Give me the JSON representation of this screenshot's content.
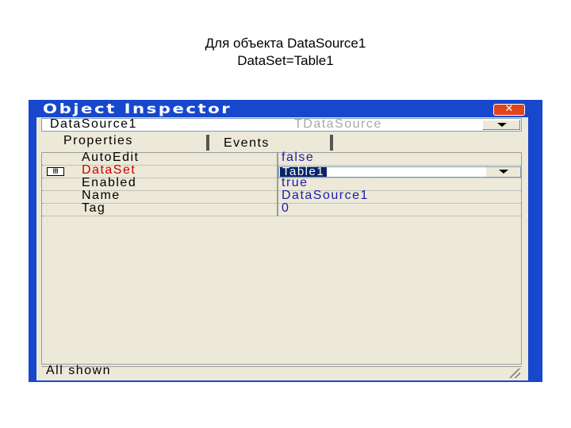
{
  "caption": {
    "line1": "Для объекта DataSource1",
    "line2": "DataSet=Table1"
  },
  "window": {
    "title": "Object Inspector",
    "close_glyph": "✕"
  },
  "selector": {
    "component_name": "DataSource1",
    "component_type": "TDataSource"
  },
  "tabs": [
    {
      "label": "Properties",
      "active": true
    },
    {
      "label": "Events",
      "active": false
    }
  ],
  "properties": [
    {
      "name": "AutoEdit",
      "value": "false"
    },
    {
      "name": "DataSet",
      "value": "Table1",
      "expandable": true,
      "selected": true
    },
    {
      "name": "Enabled",
      "value": "true"
    },
    {
      "name": "Name",
      "value": "DataSource1"
    },
    {
      "name": "Tag",
      "value": "0"
    }
  ],
  "expand_glyph": "⊞",
  "status": {
    "text": "All shown"
  },
  "colors": {
    "titlebar": "#1747cc",
    "panel": "#ece9d8",
    "value_text": "#1c1ca8",
    "selected_prop": "#cc0000",
    "selection_bg": "#0a246a"
  }
}
